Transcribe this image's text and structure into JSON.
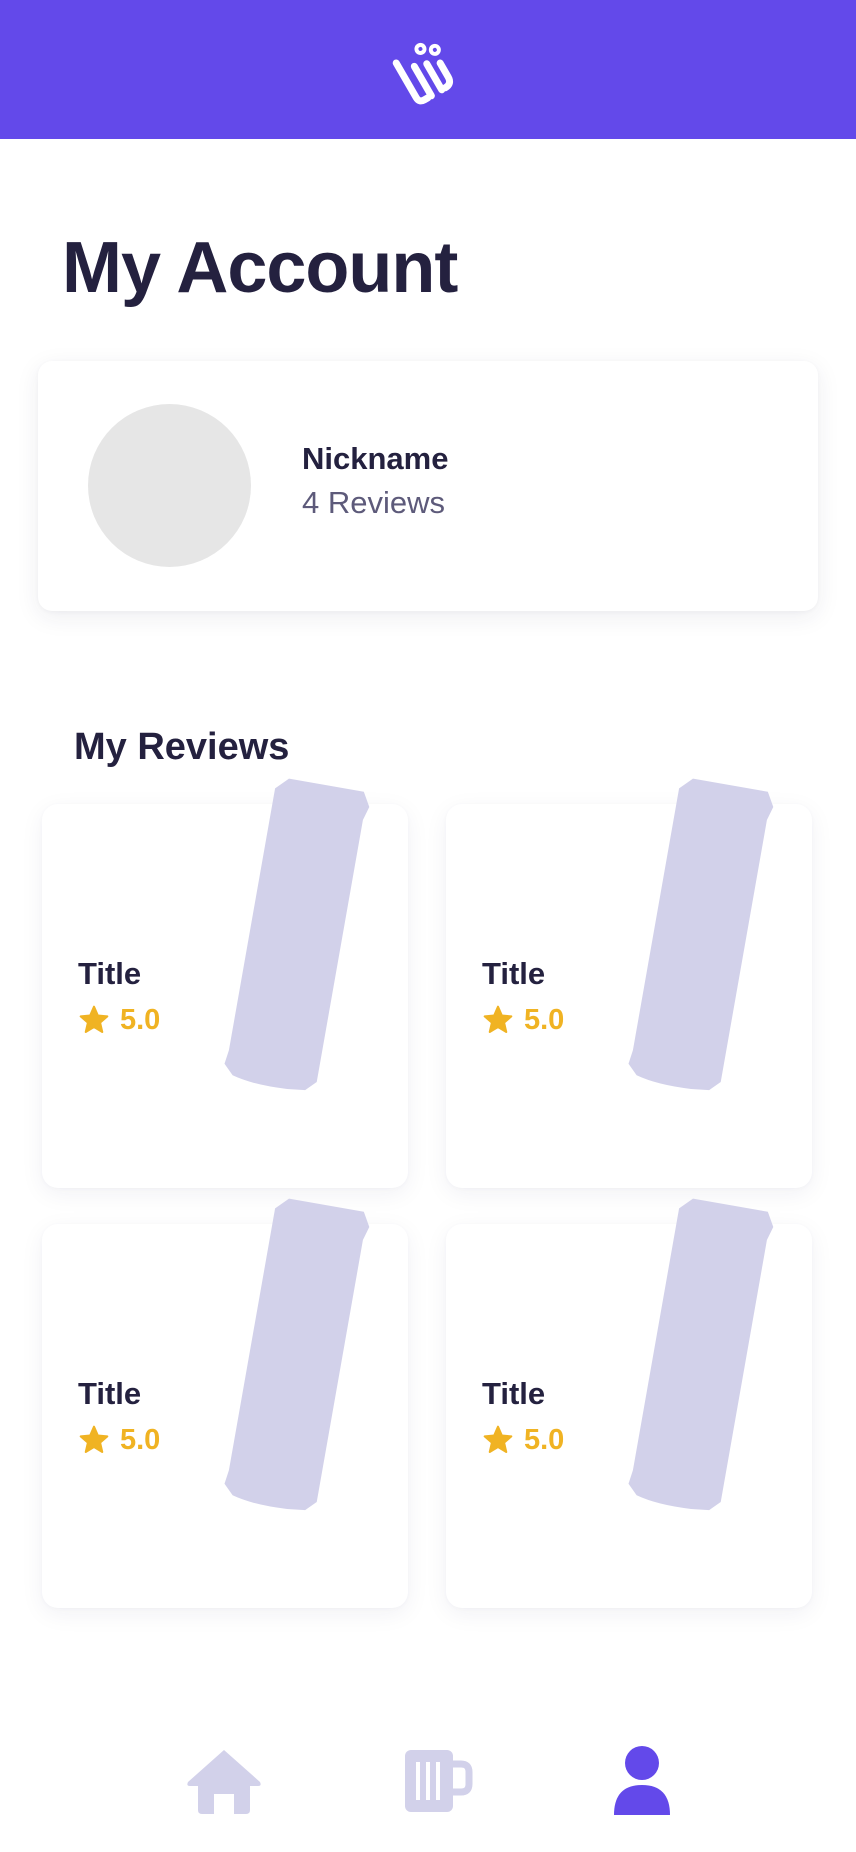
{
  "header": {
    "logo_icon": "brand-logo-icon"
  },
  "page": {
    "title": "My Account"
  },
  "profile": {
    "nickname": "Nickname",
    "review_count": "4 Reviews"
  },
  "reviews": {
    "section_title": "My Reviews",
    "items": [
      {
        "title": "Title",
        "rating": "5.0",
        "image_icon": "beer-can-icon"
      },
      {
        "title": "Title",
        "rating": "5.0",
        "image_icon": "beer-can-icon"
      },
      {
        "title": "Title",
        "rating": "5.0",
        "image_icon": "beer-can-icon"
      },
      {
        "title": "Title",
        "rating": "5.0",
        "image_icon": "beer-can-icon"
      }
    ]
  },
  "nav": {
    "items": [
      {
        "icon": "home-icon",
        "active": false
      },
      {
        "icon": "beer-mug-icon",
        "active": false
      },
      {
        "icon": "user-icon",
        "active": true
      }
    ]
  },
  "colors": {
    "brand": "#6349ea",
    "text_dark": "#24213f",
    "text_muted": "#5d5a7a",
    "rating": "#f0b323",
    "placeholder_can": "#d2d1ea",
    "avatar_placeholder": "#e6e6e6"
  }
}
